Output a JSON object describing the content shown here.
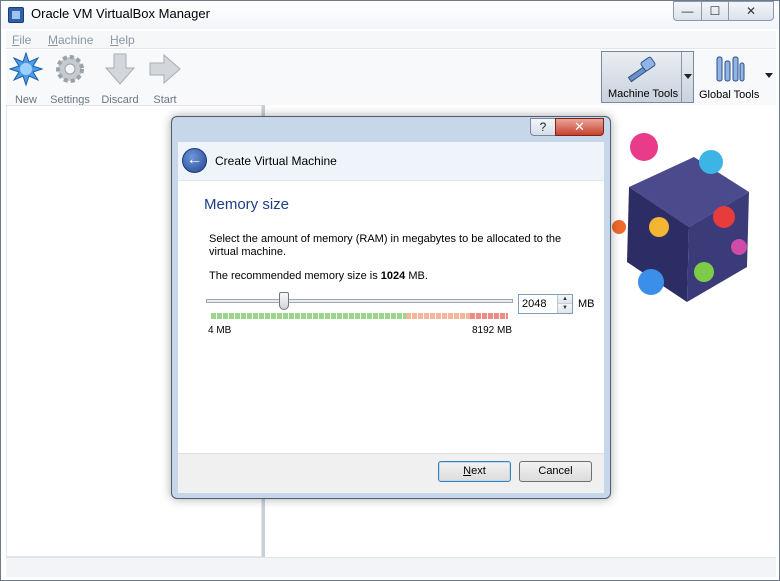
{
  "window": {
    "title": "Oracle VM VirtualBox Manager",
    "controls": {
      "minimize": "—",
      "maximize": "☐",
      "close": "✕"
    }
  },
  "menubar": {
    "items": [
      {
        "label": "File"
      },
      {
        "label": "Machine"
      },
      {
        "label": "Help"
      }
    ]
  },
  "toolbar": {
    "buttons": [
      {
        "label": "New",
        "icon": "new-star-icon"
      },
      {
        "label": "Settings",
        "icon": "gear-icon"
      },
      {
        "label": "Discard",
        "icon": "down-arrow-icon"
      },
      {
        "label": "Start",
        "icon": "right-arrow-icon"
      }
    ],
    "machine_tools": {
      "label": "Machine Tools",
      "icon": "hammer-icon"
    },
    "global_tools": {
      "label": "Global Tools",
      "icon": "tools-icon"
    }
  },
  "dialog": {
    "title": "Create Virtual Machine",
    "help_glyph": "?",
    "close_glyph": "✕",
    "back_glyph": "←",
    "heading": "Memory size",
    "description": "Select the amount of memory (RAM) in megabytes to be allocated to the virtual machine.",
    "recommend_prefix": "The recommended memory size is ",
    "recommend_value": "1024",
    "recommend_suffix": " MB.",
    "memory": {
      "value": "2048",
      "unit": "MB",
      "min_label": "4 MB",
      "max_label": "8192 MB",
      "min": 4,
      "max": 8192,
      "slider_value": 2048
    },
    "buttons": {
      "next": "Next",
      "cancel": "Cancel"
    }
  },
  "colors": {
    "accent_heading": "#1e3f86",
    "dialog_frame": "#c7d7ea",
    "safe_zone": "#9bd68b",
    "warn_zone": "#f1b69b",
    "danger_zone": "#e98d86"
  }
}
